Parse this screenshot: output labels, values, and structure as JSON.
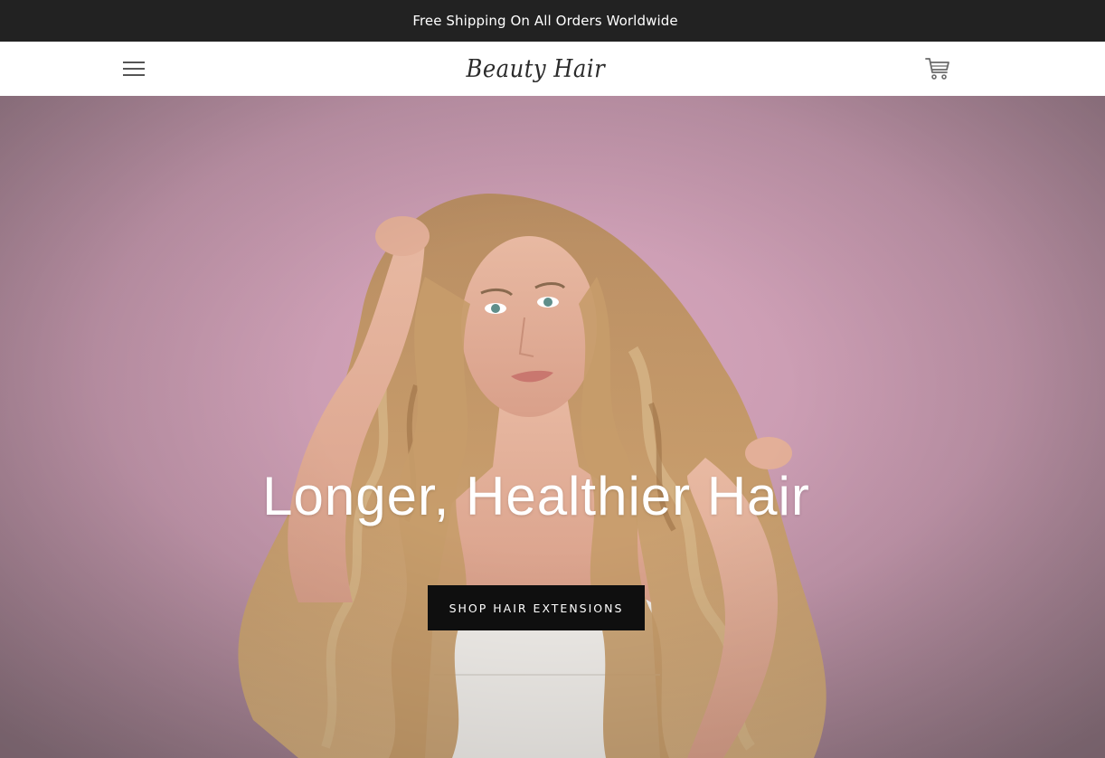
{
  "announcement": {
    "text": "Free Shipping On All Orders Worldwide"
  },
  "header": {
    "menu_icon": "hamburger-menu-icon",
    "logo_text": "Beauty Hair",
    "cart_icon": "shopping-cart-icon"
  },
  "hero": {
    "image_description": "woman-with-long-wavy-hair",
    "title": "Longer, Healthier Hair",
    "cta_label": "SHOP HAIR EXTENSIONS"
  },
  "colors": {
    "announcement_bg": "#222222",
    "header_bg": "#ffffff",
    "hero_bg": "#c497ab",
    "cta_bg": "#0f0f0f",
    "text_light": "#ffffff"
  }
}
